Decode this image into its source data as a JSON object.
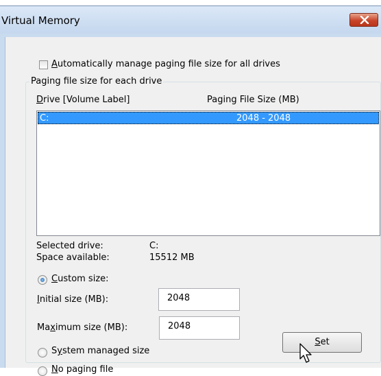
{
  "window": {
    "title": "Virtual Memory"
  },
  "auto_manage": {
    "label_pre": "",
    "label_key": "A",
    "label_post": "utomatically manage paging file size for all drives",
    "checked": false
  },
  "group": {
    "title": "Paging file size for each drive"
  },
  "list": {
    "col_drive_key": "D",
    "col_drive_rest": "rive  [Volume Label]",
    "col_size": "Paging File Size (MB)",
    "rows": [
      {
        "drive": "C:",
        "size": "2048 - 2048",
        "selected": true
      }
    ]
  },
  "info": {
    "selected_drive_label": "Selected drive:",
    "selected_drive_value": "C:",
    "space_label": "Space available:",
    "space_value": "15512 MB"
  },
  "custom": {
    "label_key": "C",
    "label_rest": "ustom size:",
    "checked": true,
    "initial_key": "I",
    "initial_rest": "nitial size (MB):",
    "initial_value": "2048",
    "max_pre": "Ma",
    "max_key": "x",
    "max_rest": "imum size (MB):",
    "max_value": "2048"
  },
  "system_managed": {
    "pre": "S",
    "key": "y",
    "rest": "stem managed size",
    "checked": false
  },
  "no_paging": {
    "key": "N",
    "rest": "o paging file",
    "checked": false
  },
  "set_button": {
    "key": "S",
    "rest": "et"
  },
  "icons": {
    "close": "close-icon",
    "cursor": "mouse-pointer-icon"
  }
}
